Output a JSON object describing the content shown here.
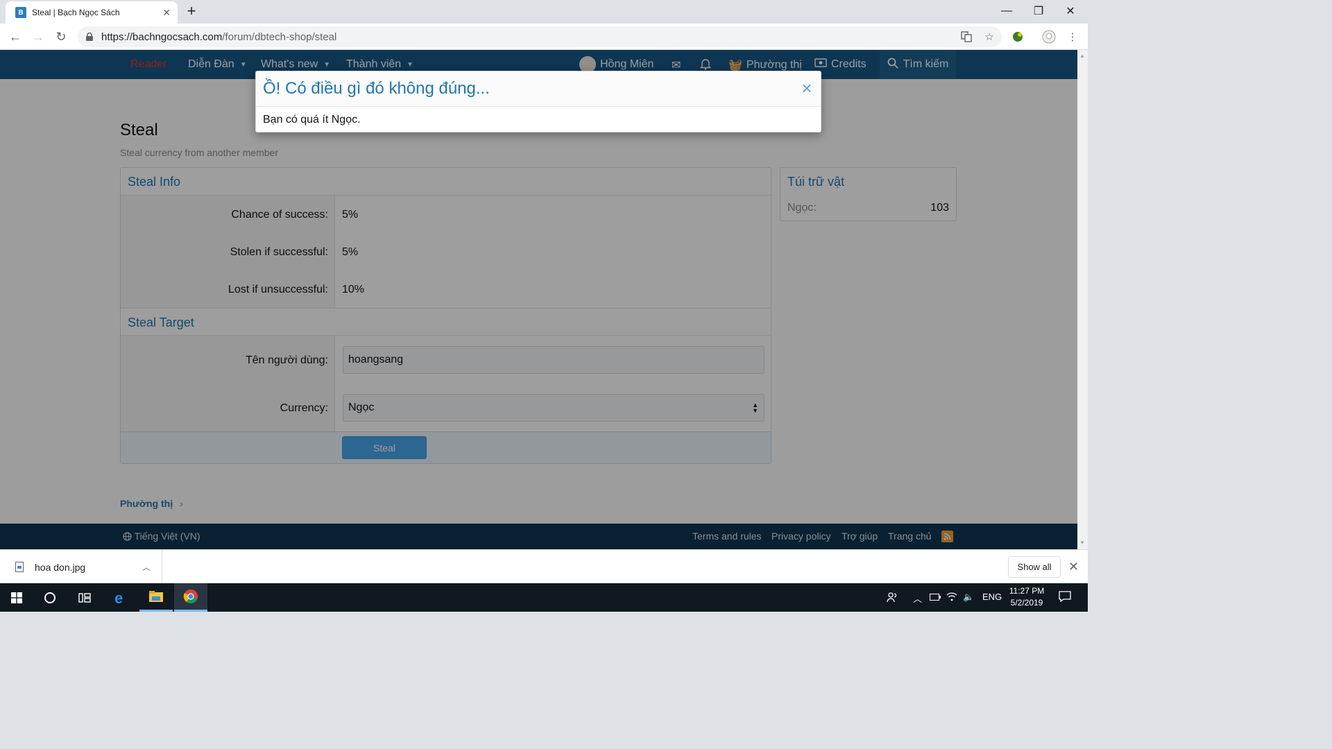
{
  "browser": {
    "tab_title": "Steal | Bạch Ngọc Sách",
    "url_host": "https://bachngocsach.com",
    "url_path": "/forum/dbtech-shop/steal"
  },
  "nav": {
    "reader": "Reader",
    "forums": "Diễn Đàn",
    "whats_new": "What's new",
    "members": "Thành viên",
    "user_name": "Hồng Miên",
    "shop": "Phường thị",
    "credits": "Credits",
    "search": "Tìm kiếm"
  },
  "page": {
    "title": "Steal",
    "description": "Steal currency from another member"
  },
  "steal_info": {
    "heading": "Steal Info",
    "rows": [
      {
        "label": "Chance of success:",
        "value": "5%"
      },
      {
        "label": "Stolen if successful:",
        "value": "5%"
      },
      {
        "label": "Lost if unsuccessful:",
        "value": "10%"
      }
    ]
  },
  "steal_target": {
    "heading": "Steal Target",
    "username_label": "Tên người dùng:",
    "username_value": "hoangsang",
    "currency_label": "Currency:",
    "currency_value": "Ngọc",
    "submit_label": "Steal"
  },
  "inventory": {
    "heading": "Túi trữ vật",
    "label": "Ngọc:",
    "value": "103"
  },
  "breadcrumb": "Phường thị",
  "footer": {
    "language": "Tiếng Việt (VN)",
    "links": [
      "Terms and rules",
      "Privacy policy",
      "Trợ giúp",
      "Trang chủ"
    ]
  },
  "modal": {
    "title": "Ồ! Có điều gì đó không đúng...",
    "message": "Bạn có quá ít Ngọc."
  },
  "downloads": {
    "file_name": "hoa don.jpg",
    "show_all": "Show all"
  },
  "taskbar": {
    "language": "ENG",
    "time": "11:27 PM",
    "date": "5/2/2019"
  },
  "colors": {
    "header_bg": "#185886",
    "link_blue": "#2577b1",
    "button_blue": "#47a7eb",
    "footer_bg": "#0f3652"
  }
}
